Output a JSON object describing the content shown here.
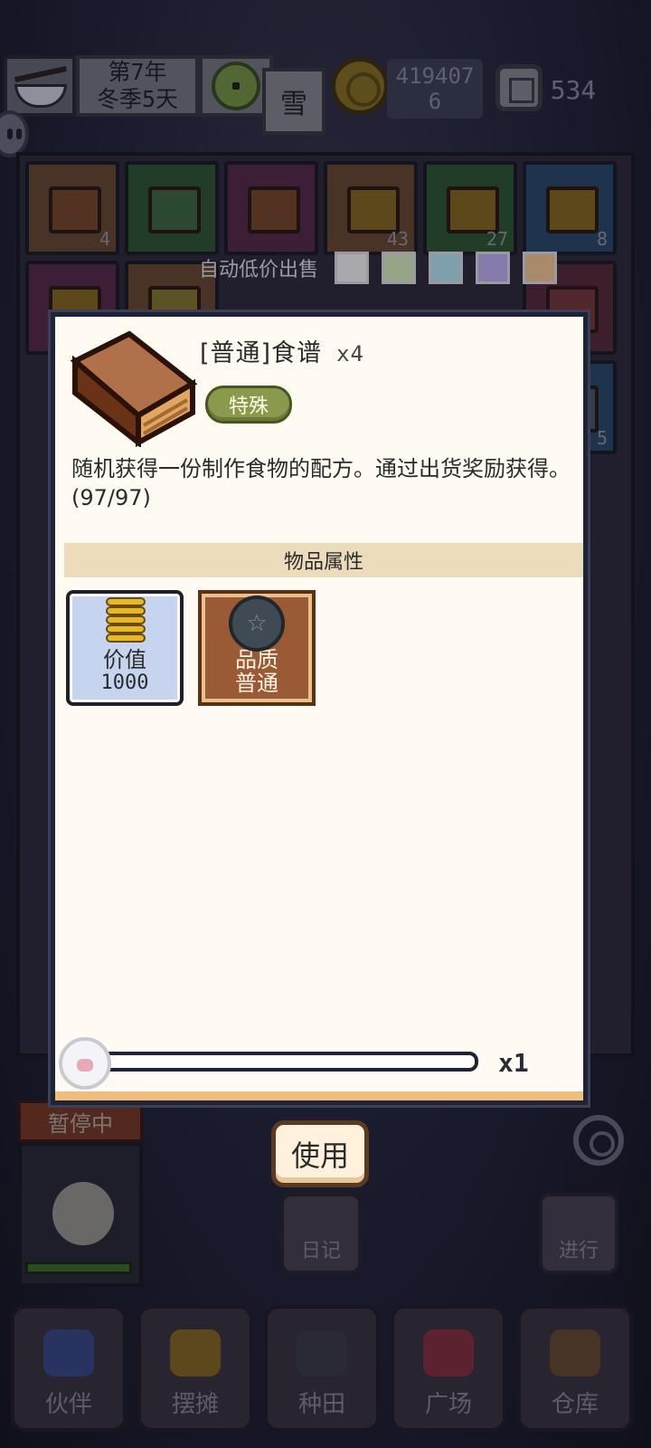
{
  "top_bar": {
    "date_line1": "第7年",
    "date_line2": "冬季5天",
    "weather": "雪",
    "gold_line1": "419407",
    "gold_line2": "6",
    "gems": "534"
  },
  "inventory": {
    "counts": [
      "4",
      "43",
      "27",
      "8",
      "5"
    ],
    "auto_sell_label": "自动低价出售",
    "auto_sell_colors": [
      "#ffffff",
      "#e4f7c7",
      "#bdf2ff",
      "#cbb8ff",
      "#ffcf9a"
    ]
  },
  "dialog": {
    "item_name": "[普通]食谱",
    "item_count": "x4",
    "tag": "特殊",
    "description": "随机获得一份制作食物的配方。通过出货奖励获得。(97/97)",
    "section_title": "物品属性",
    "value_label": "价值",
    "value_amount": "1000",
    "quality_label": "品质",
    "quality_value": "普通",
    "quantity": "x1",
    "slider_fraction": 0.0
  },
  "use_button": "使用",
  "status_label": "暂停中",
  "diary_label": "日记",
  "go_label": "进行",
  "nav": [
    {
      "label": "伙伴",
      "icon": "partner-icon",
      "color": "#3b4a8a"
    },
    {
      "label": "摆摊",
      "icon": "stall-icon",
      "color": "#8a6a24"
    },
    {
      "label": "种田",
      "icon": "farm-icon",
      "color": "#3c3c44"
    },
    {
      "label": "广场",
      "icon": "plaza-icon",
      "color": "#8a3040"
    },
    {
      "label": "仓库",
      "icon": "warehouse-icon",
      "color": "#6a4a32"
    }
  ]
}
